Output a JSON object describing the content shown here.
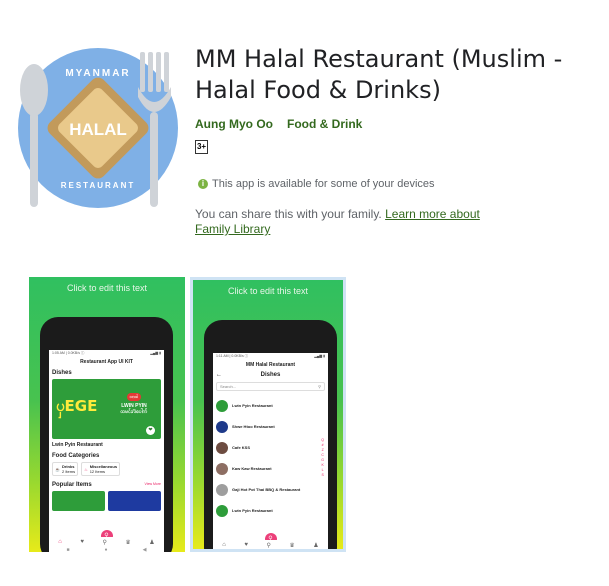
{
  "app": {
    "title": "MM Halal Restaurant (Muslim - Halal Food & Drinks)",
    "developer": "Aung Myo Oo",
    "category": "Food & Drink",
    "rating_badge": "3+",
    "availability": "This app is available for some of your devices",
    "share_text": "You can share this with your family.",
    "share_link": "Learn more about Family Library",
    "icon_text": {
      "top": "MYANMAR",
      "center": "HALAL",
      "bottom": "RESTAURANT"
    }
  },
  "screenshots": [
    {
      "caption": "Click to edit this text",
      "status_left": "1:05 AM | 0.0KB/s ⓘ",
      "status_right": "▂▄▆ ▮",
      "screen_title": "Restaurant App UI KIT",
      "section": "Dishes",
      "banner_big": "ၦEGE",
      "banner_tag": "လားပဲ",
      "banner_right_line1": "LWIN PYIN",
      "banner_right_line2": "ထမင်း/ဒံပေါက်",
      "banner_heart": "❤",
      "banner_name": "Lwin Pyin Restaurant",
      "food_categories": "Food Categories",
      "categories": [
        {
          "name": "Drinks",
          "sub": "2 Items",
          "icon": "drink-icon"
        },
        {
          "name": "Miscellaneous",
          "sub": "12 Items",
          "icon": "misc-icon"
        }
      ],
      "popular": "Popular Items",
      "view_more": "View More",
      "nav": [
        "⌂",
        "♥",
        "⚲",
        "♛",
        "♟"
      ],
      "sysnav": [
        "■",
        "●",
        "◀"
      ]
    },
    {
      "caption": "Click to edit this text",
      "status_left": "1:11 AM | 0.0KB/s ⓘ",
      "status_right": "▂▄▆ ▮",
      "screen_title": "MM Halal Restaurant",
      "back_arrow": "←",
      "page_title": "Dishes",
      "search_placeholder": "Search...",
      "search_icon": "⚲",
      "restaurants": [
        {
          "name": "Lwin Pyin Restaurant",
          "color": "#2e9d3a"
        },
        {
          "name": "Shwe Htoo Restaurant",
          "color": "#1e3a8a"
        },
        {
          "name": "Cafe KSS",
          "color": "#6d4c41"
        },
        {
          "name": "Kaw Kaw Restaurant",
          "color": "#8d6e63"
        },
        {
          "name": "Gaji Hot Pot Thai BBQ & Restaurant",
          "color": "#9e9e9e"
        },
        {
          "name": "Lwin Pyin Restaurant",
          "color": "#2e9d3a"
        }
      ],
      "alphabet": [
        "Q",
        "#",
        "Z",
        "C",
        "G",
        "K",
        "L",
        "S"
      ],
      "nav": [
        "⌂",
        "♥",
        "⚲",
        "♛",
        "♟"
      ],
      "sysnav": [
        "■",
        "●",
        "◀"
      ]
    }
  ],
  "colors": {
    "accent_green": "#33691e",
    "pink": "#ec407a"
  }
}
